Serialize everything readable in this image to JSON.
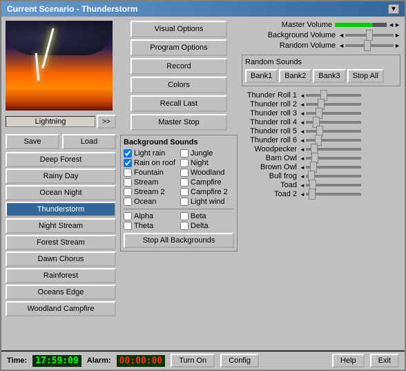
{
  "window": {
    "title": "Current Scenario - Thunderstorm"
  },
  "preview": {
    "label": "Lightning",
    "arrow_label": ">>"
  },
  "left_buttons": {
    "save": "Save",
    "load": "Load"
  },
  "scenarios": [
    {
      "label": "Deep Forest",
      "active": false
    },
    {
      "label": "Rainy Day",
      "active": false
    },
    {
      "label": "Ocean Night",
      "active": false
    },
    {
      "label": "Thunderstorm",
      "active": true
    },
    {
      "label": "Night Stream",
      "active": false
    },
    {
      "label": "Forest Stream",
      "active": false
    },
    {
      "label": "Dawn Chorus",
      "active": false
    },
    {
      "label": "Rainforest",
      "active": false
    },
    {
      "label": "Oceans Edge",
      "active": false
    },
    {
      "label": "Woodland Campfire",
      "active": false
    }
  ],
  "center_buttons": [
    {
      "label": "Visual Options"
    },
    {
      "label": "Program Options"
    },
    {
      "label": "Record"
    },
    {
      "label": "Colors"
    },
    {
      "label": "Recall Last"
    },
    {
      "label": "Master Stop"
    }
  ],
  "bg_sounds": {
    "title": "Background Sounds",
    "items": [
      {
        "label": "Light rain",
        "checked": true,
        "col": 0
      },
      {
        "label": "Jungle",
        "checked": false,
        "col": 1
      },
      {
        "label": "Rain on roof",
        "checked": true,
        "col": 0
      },
      {
        "label": "Night",
        "checked": false,
        "col": 1
      },
      {
        "label": "Fountain",
        "checked": false,
        "col": 0
      },
      {
        "label": "Woodland",
        "checked": false,
        "col": 1
      },
      {
        "label": "Stream",
        "checked": false,
        "col": 0
      },
      {
        "label": "Campfire",
        "checked": false,
        "col": 1
      },
      {
        "label": "Stream 2",
        "checked": false,
        "col": 0
      },
      {
        "label": "Campfire 2",
        "checked": false,
        "col": 1
      },
      {
        "label": "Ocean",
        "checked": false,
        "col": 0
      },
      {
        "label": "Light wind",
        "checked": false,
        "col": 1
      }
    ],
    "brainwave_items": [
      {
        "label": "Alpha",
        "checked": false,
        "col": 0
      },
      {
        "label": "Beta",
        "checked": false,
        "col": 1
      },
      {
        "label": "Theta",
        "checked": false,
        "col": 0
      },
      {
        "label": "Delta",
        "checked": false,
        "col": 1
      }
    ],
    "stop_btn": "Stop All Backgrounds"
  },
  "volumes": {
    "master_label": "Master Volume",
    "background_label": "Background Volume",
    "random_label": "Random Volume",
    "master_value": 85,
    "background_value": 50,
    "random_value": 45
  },
  "random_sounds": {
    "title": "Random Sounds",
    "bank1": "Bank1",
    "bank2": "Bank2",
    "bank3": "Bank3",
    "stop_all": "Stop All",
    "sounds": [
      {
        "label": "Thunder Roll 1",
        "value": 30
      },
      {
        "label": "Thunder roll 2",
        "value": 25
      },
      {
        "label": "Thunder roll 3",
        "value": 20
      },
      {
        "label": "Thunder roll 4",
        "value": 15
      },
      {
        "label": "Thunder roll 5",
        "value": 22
      },
      {
        "label": "Thunder roll 6",
        "value": 18
      },
      {
        "label": "Woodpecker",
        "value": 10
      },
      {
        "label": "Barn Owl",
        "value": 12
      },
      {
        "label": "Brown Owl",
        "value": 8
      },
      {
        "label": "Bull frog",
        "value": 5
      },
      {
        "label": "Toad",
        "value": 7
      },
      {
        "label": "Toad 2",
        "value": 6
      }
    ]
  },
  "status_bar": {
    "time_label": "Time:",
    "time_value": "17:59:09",
    "alarm_label": "Alarm:",
    "alarm_value": "00:00:00",
    "turn_on": "Turn On",
    "config": "Config",
    "help": "Help",
    "exit": "Exit"
  }
}
